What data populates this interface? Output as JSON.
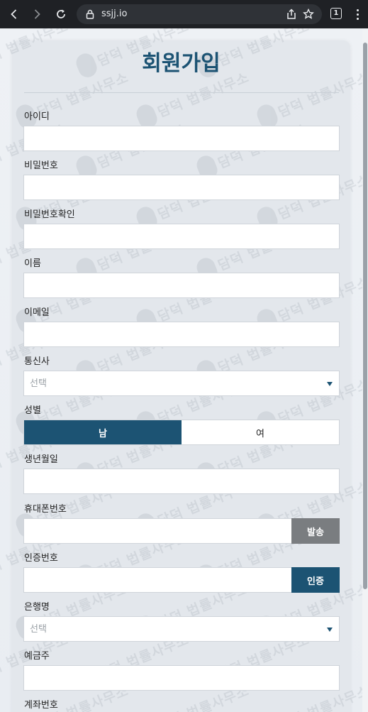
{
  "browser": {
    "url": "ssjj.io",
    "tab_count": "1"
  },
  "form": {
    "title": "회원가입",
    "fields": {
      "user_id": {
        "label": "아이디",
        "value": ""
      },
      "password": {
        "label": "비밀번호",
        "value": ""
      },
      "password_confirm": {
        "label": "비밀번호확인",
        "value": ""
      },
      "name": {
        "label": "이름",
        "value": ""
      },
      "email": {
        "label": "이메일",
        "value": ""
      },
      "carrier": {
        "label": "통신사",
        "selected": "선택"
      },
      "gender": {
        "label": "성별",
        "male": "남",
        "female": "여",
        "selected": "남"
      },
      "birthdate": {
        "label": "생년월일",
        "value": ""
      },
      "phone": {
        "label": "휴대폰번호",
        "value": "",
        "button": "발송"
      },
      "auth_code": {
        "label": "인증번호",
        "value": "",
        "button": "인증"
      },
      "bank": {
        "label": "은행명",
        "selected": "선택"
      },
      "account_holder": {
        "label": "예금주",
        "value": ""
      },
      "account_number": {
        "label": "계좌번호"
      }
    }
  },
  "watermark": {
    "text": "담덕 법률사무소"
  },
  "colors": {
    "accent": "#1c5373",
    "send_button": "#7a7d80",
    "chrome": "#1f2125"
  }
}
